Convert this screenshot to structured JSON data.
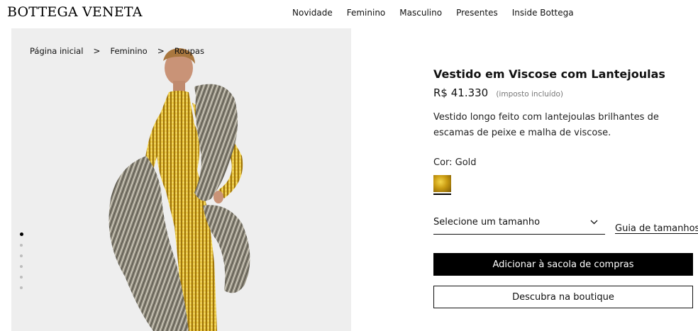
{
  "brand": {
    "logo_text": "BOTTEGA VENETA"
  },
  "topnav": [
    {
      "label": "Novidade"
    },
    {
      "label": "Feminino"
    },
    {
      "label": "Masculino"
    },
    {
      "label": "Presentes"
    },
    {
      "label": "Inside Bottega"
    }
  ],
  "breadcrumb": {
    "items": [
      {
        "label": "Página inicial"
      },
      {
        "label": "Feminino"
      },
      {
        "label": "Roupas"
      }
    ],
    "separator": ">"
  },
  "gallery": {
    "image_count": 6,
    "active_index": 0,
    "background_color": "#eeeeee"
  },
  "product": {
    "title": "Vestido em Viscose com Lantejoulas",
    "price": "R$ 41.330",
    "tax_note": "(imposto incluído)",
    "description": "Vestido longo feito com lantejoulas brilhantes de escamas de peixe e malha de viscose.",
    "color_label": "Cor: Gold",
    "swatch_color": "#d4a817"
  },
  "size": {
    "placeholder": "Selecione um tamanho",
    "guide_label": "Guia de tamanhos"
  },
  "actions": {
    "add_to_bag": "Adicionar à sacola de compras",
    "find_in_boutique": "Descubra na boutique"
  },
  "colors": {
    "primary_button_bg": "#000000",
    "primary_button_text": "#ffffff",
    "text": "#111111",
    "muted": "#777777"
  }
}
